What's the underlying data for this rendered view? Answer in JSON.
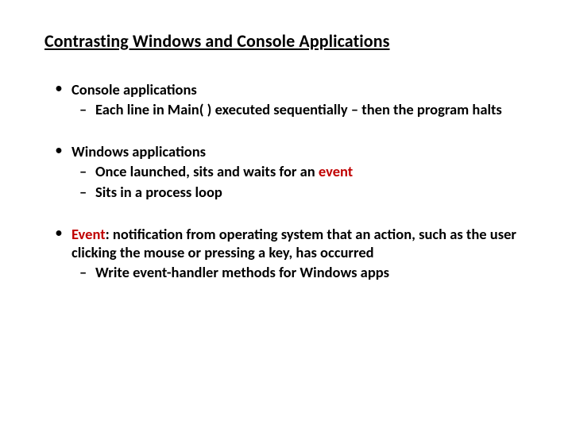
{
  "title": "Contrasting Windows and Console Applications",
  "b1": {
    "head": "Console applications",
    "sub1a": "Each line in Main( ) executed sequentially ",
    "sub1b": "– then the program halts"
  },
  "b2": {
    "head": "Windows applications",
    "sub1": "Once launched, sits and waits for an ",
    "sub1_em": "event",
    "sub2": "Sits in a process loop"
  },
  "b3": {
    "head_em": "Event",
    "head_rest": ": notification from operating system that an action, such as the user clicking the mouse or pressing a key, has occurred",
    "sub1": "Write event-handler methods for Windows apps"
  }
}
